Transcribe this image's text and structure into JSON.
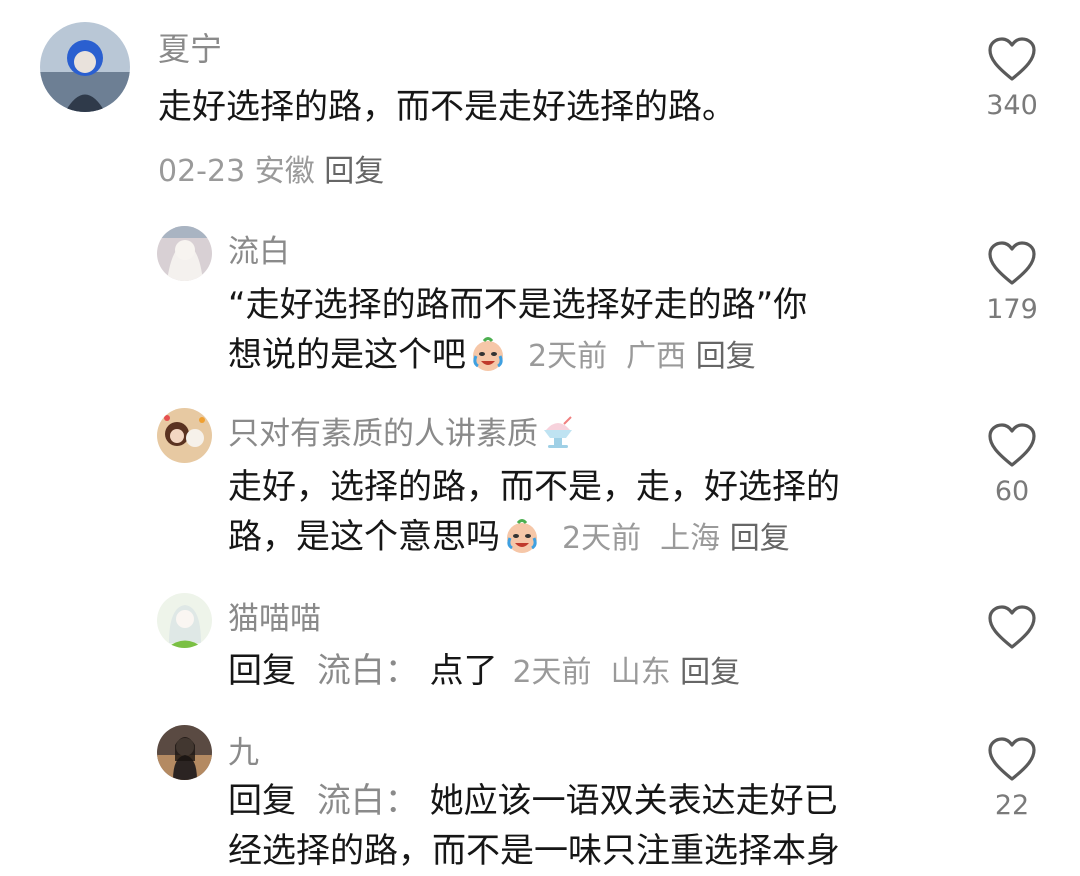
{
  "comments": [
    {
      "name": "夏宁",
      "text": "走好选择的路，而不是走好选择的路。",
      "date": "02-23",
      "location": "安徽",
      "reply_label": "回复",
      "likes": "340"
    },
    {
      "name": "流白",
      "text_line1": "“走好选择的路而不是选择好走的路”你",
      "text_line2": "想说的是这个吧",
      "date": "2天前",
      "location": "广西",
      "reply_label": "回复",
      "likes": "179"
    },
    {
      "name": "只对有素质的人讲素质",
      "text_line1": "走好，选择的路，而不是，走，好选择的",
      "text_line2": "路，是这个意思吗",
      "date": "2天前",
      "location": "上海",
      "reply_label": "回复",
      "likes": "60"
    },
    {
      "name": "猫喵喵",
      "reply_prefix": "回复",
      "reply_to": "流白：",
      "text": "点了",
      "date": "2天前",
      "location": "山东",
      "reply_label": "回复",
      "likes": ""
    },
    {
      "name": "九",
      "reply_prefix": "回复",
      "reply_to": "流白：",
      "text_line1": "她应该一语双关表达走好已",
      "text_line2": "经选择的路，而不是一味只注重选择本身",
      "likes": "22"
    }
  ],
  "icons": {
    "like": "heart-outline-icon",
    "emoji": "laughing-crying-emoji-icon",
    "name_emoji": "shaved-ice-emoji-icon"
  },
  "colors": {
    "name": "#8a8a8a",
    "meta": "#9a9a9a",
    "text": "#161616"
  }
}
